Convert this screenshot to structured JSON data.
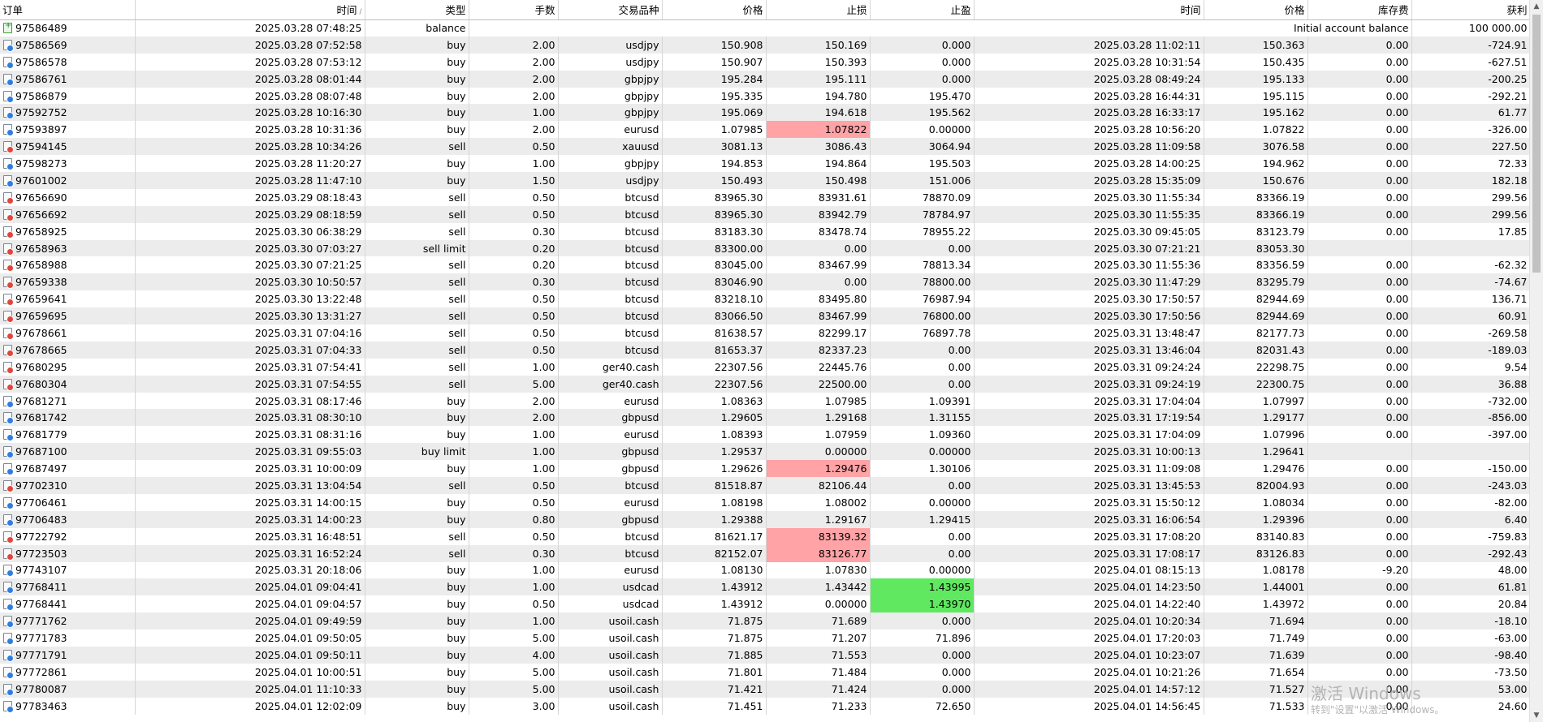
{
  "columns": [
    "订单",
    "时间",
    "类型",
    "手数",
    "交易品种",
    "价格",
    "止损",
    "止盈",
    "时间",
    "价格",
    "库存费",
    "获利"
  ],
  "sort_indicator": "/",
  "balance_row": {
    "order": "97586489",
    "time": "2025.03.28 07:48:25",
    "type": "balance",
    "comment": "Initial account balance",
    "profit": "100 000.00"
  },
  "rows": [
    {
      "order": "97586569",
      "time": "2025.03.28 07:52:58",
      "type": "buy",
      "volume": "2.00",
      "symbol": "usdjpy",
      "price": "150.908",
      "sl": "150.169",
      "tp": "0.000",
      "close_time": "2025.03.28 11:02:11",
      "close_price": "150.363",
      "swap": "0.00",
      "profit": "-724.91"
    },
    {
      "order": "97586578",
      "time": "2025.03.28 07:53:12",
      "type": "buy",
      "volume": "2.00",
      "symbol": "usdjpy",
      "price": "150.907",
      "sl": "150.393",
      "tp": "0.000",
      "close_time": "2025.03.28 10:31:54",
      "close_price": "150.435",
      "swap": "0.00",
      "profit": "-627.51"
    },
    {
      "order": "97586761",
      "time": "2025.03.28 08:01:44",
      "type": "buy",
      "volume": "2.00",
      "symbol": "gbpjpy",
      "price": "195.284",
      "sl": "195.111",
      "tp": "0.000",
      "close_time": "2025.03.28 08:49:24",
      "close_price": "195.133",
      "swap": "0.00",
      "profit": "-200.25"
    },
    {
      "order": "97586879",
      "time": "2025.03.28 08:07:48",
      "type": "buy",
      "volume": "2.00",
      "symbol": "gbpjpy",
      "price": "195.335",
      "sl": "194.780",
      "tp": "195.470",
      "close_time": "2025.03.28 16:44:31",
      "close_price": "195.115",
      "swap": "0.00",
      "profit": "-292.21"
    },
    {
      "order": "97592752",
      "time": "2025.03.28 10:16:30",
      "type": "buy",
      "volume": "1.00",
      "symbol": "gbpjpy",
      "price": "195.069",
      "sl": "194.618",
      "tp": "195.562",
      "close_time": "2025.03.28 16:33:17",
      "close_price": "195.162",
      "swap": "0.00",
      "profit": "61.77"
    },
    {
      "order": "97593897",
      "time": "2025.03.28 10:31:36",
      "type": "buy",
      "volume": "2.00",
      "symbol": "eurusd",
      "price": "1.07985",
      "sl": "1.07822",
      "tp": "0.00000",
      "close_time": "2025.03.28 10:56:20",
      "close_price": "1.07822",
      "swap": "0.00",
      "profit": "-326.00",
      "sl_hit": true
    },
    {
      "order": "97594145",
      "time": "2025.03.28 10:34:26",
      "type": "sell",
      "volume": "0.50",
      "symbol": "xauusd",
      "price": "3081.13",
      "sl": "3086.43",
      "tp": "3064.94",
      "close_time": "2025.03.28 11:09:58",
      "close_price": "3076.58",
      "swap": "0.00",
      "profit": "227.50"
    },
    {
      "order": "97598273",
      "time": "2025.03.28 11:20:27",
      "type": "buy",
      "volume": "1.00",
      "symbol": "gbpjpy",
      "price": "194.853",
      "sl": "194.864",
      "tp": "195.503",
      "close_time": "2025.03.28 14:00:25",
      "close_price": "194.962",
      "swap": "0.00",
      "profit": "72.33"
    },
    {
      "order": "97601002",
      "time": "2025.03.28 11:47:10",
      "type": "buy",
      "volume": "1.50",
      "symbol": "usdjpy",
      "price": "150.493",
      "sl": "150.498",
      "tp": "151.006",
      "close_time": "2025.03.28 15:35:09",
      "close_price": "150.676",
      "swap": "0.00",
      "profit": "182.18"
    },
    {
      "order": "97656690",
      "time": "2025.03.29 08:18:43",
      "type": "sell",
      "volume": "0.50",
      "symbol": "btcusd",
      "price": "83965.30",
      "sl": "83931.61",
      "tp": "78870.09",
      "close_time": "2025.03.30 11:55:34",
      "close_price": "83366.19",
      "swap": "0.00",
      "profit": "299.56"
    },
    {
      "order": "97656692",
      "time": "2025.03.29 08:18:59",
      "type": "sell",
      "volume": "0.50",
      "symbol": "btcusd",
      "price": "83965.30",
      "sl": "83942.79",
      "tp": "78784.97",
      "close_time": "2025.03.30 11:55:35",
      "close_price": "83366.19",
      "swap": "0.00",
      "profit": "299.56"
    },
    {
      "order": "97658925",
      "time": "2025.03.30 06:38:29",
      "type": "sell",
      "volume": "0.30",
      "symbol": "btcusd",
      "price": "83183.30",
      "sl": "83478.74",
      "tp": "78955.22",
      "close_time": "2025.03.30 09:45:05",
      "close_price": "83123.79",
      "swap": "0.00",
      "profit": "17.85"
    },
    {
      "order": "97658963",
      "time": "2025.03.30 07:03:27",
      "type": "sell limit",
      "volume": "0.20",
      "symbol": "btcusd",
      "price": "83300.00",
      "sl": "0.00",
      "tp": "0.00",
      "close_time": "2025.03.30 07:21:21",
      "close_price": "83053.30",
      "swap": "",
      "profit": "",
      "pending": true
    },
    {
      "order": "97658988",
      "time": "2025.03.30 07:21:25",
      "type": "sell",
      "volume": "0.20",
      "symbol": "btcusd",
      "price": "83045.00",
      "sl": "83467.99",
      "tp": "78813.34",
      "close_time": "2025.03.30 11:55:36",
      "close_price": "83356.59",
      "swap": "0.00",
      "profit": "-62.32"
    },
    {
      "order": "97659338",
      "time": "2025.03.30 10:50:57",
      "type": "sell",
      "volume": "0.30",
      "symbol": "btcusd",
      "price": "83046.90",
      "sl": "0.00",
      "tp": "78800.00",
      "close_time": "2025.03.30 11:47:29",
      "close_price": "83295.79",
      "swap": "0.00",
      "profit": "-74.67"
    },
    {
      "order": "97659641",
      "time": "2025.03.30 13:22:48",
      "type": "sell",
      "volume": "0.50",
      "symbol": "btcusd",
      "price": "83218.10",
      "sl": "83495.80",
      "tp": "76987.94",
      "close_time": "2025.03.30 17:50:57",
      "close_price": "82944.69",
      "swap": "0.00",
      "profit": "136.71"
    },
    {
      "order": "97659695",
      "time": "2025.03.30 13:31:27",
      "type": "sell",
      "volume": "0.50",
      "symbol": "btcusd",
      "price": "83066.50",
      "sl": "83467.99",
      "tp": "76800.00",
      "close_time": "2025.03.30 17:50:56",
      "close_price": "82944.69",
      "swap": "0.00",
      "profit": "60.91"
    },
    {
      "order": "97678661",
      "time": "2025.03.31 07:04:16",
      "type": "sell",
      "volume": "0.50",
      "symbol": "btcusd",
      "price": "81638.57",
      "sl": "82299.17",
      "tp": "76897.78",
      "close_time": "2025.03.31 13:48:47",
      "close_price": "82177.73",
      "swap": "0.00",
      "profit": "-269.58"
    },
    {
      "order": "97678665",
      "time": "2025.03.31 07:04:33",
      "type": "sell",
      "volume": "0.50",
      "symbol": "btcusd",
      "price": "81653.37",
      "sl": "82337.23",
      "tp": "0.00",
      "close_time": "2025.03.31 13:46:04",
      "close_price": "82031.43",
      "swap": "0.00",
      "profit": "-189.03"
    },
    {
      "order": "97680295",
      "time": "2025.03.31 07:54:41",
      "type": "sell",
      "volume": "1.00",
      "symbol": "ger40.cash",
      "price": "22307.56",
      "sl": "22445.76",
      "tp": "0.00",
      "close_time": "2025.03.31 09:24:24",
      "close_price": "22298.75",
      "swap": "0.00",
      "profit": "9.54"
    },
    {
      "order": "97680304",
      "time": "2025.03.31 07:54:55",
      "type": "sell",
      "volume": "5.00",
      "symbol": "ger40.cash",
      "price": "22307.56",
      "sl": "22500.00",
      "tp": "0.00",
      "close_time": "2025.03.31 09:24:19",
      "close_price": "22300.75",
      "swap": "0.00",
      "profit": "36.88"
    },
    {
      "order": "97681271",
      "time": "2025.03.31 08:17:46",
      "type": "buy",
      "volume": "2.00",
      "symbol": "eurusd",
      "price": "1.08363",
      "sl": "1.07985",
      "tp": "1.09391",
      "close_time": "2025.03.31 17:04:04",
      "close_price": "1.07997",
      "swap": "0.00",
      "profit": "-732.00"
    },
    {
      "order": "97681742",
      "time": "2025.03.31 08:30:10",
      "type": "buy",
      "volume": "2.00",
      "symbol": "gbpusd",
      "price": "1.29605",
      "sl": "1.29168",
      "tp": "1.31155",
      "close_time": "2025.03.31 17:19:54",
      "close_price": "1.29177",
      "swap": "0.00",
      "profit": "-856.00"
    },
    {
      "order": "97681779",
      "time": "2025.03.31 08:31:16",
      "type": "buy",
      "volume": "1.00",
      "symbol": "eurusd",
      "price": "1.08393",
      "sl": "1.07959",
      "tp": "1.09360",
      "close_time": "2025.03.31 17:04:09",
      "close_price": "1.07996",
      "swap": "0.00",
      "profit": "-397.00"
    },
    {
      "order": "97687100",
      "time": "2025.03.31 09:55:03",
      "type": "buy limit",
      "volume": "1.00",
      "symbol": "gbpusd",
      "price": "1.29537",
      "sl": "0.00000",
      "tp": "0.00000",
      "close_time": "2025.03.31 10:00:13",
      "close_price": "1.29641",
      "swap": "",
      "profit": "",
      "pending": true
    },
    {
      "order": "97687497",
      "time": "2025.03.31 10:00:09",
      "type": "buy",
      "volume": "1.00",
      "symbol": "gbpusd",
      "price": "1.29626",
      "sl": "1.29476",
      "tp": "1.30106",
      "close_time": "2025.03.31 11:09:08",
      "close_price": "1.29476",
      "swap": "0.00",
      "profit": "-150.00",
      "sl_hit": true
    },
    {
      "order": "97702310",
      "time": "2025.03.31 13:04:54",
      "type": "sell",
      "volume": "0.50",
      "symbol": "btcusd",
      "price": "81518.87",
      "sl": "82106.44",
      "tp": "0.00",
      "close_time": "2025.03.31 13:45:53",
      "close_price": "82004.93",
      "swap": "0.00",
      "profit": "-243.03"
    },
    {
      "order": "97706461",
      "time": "2025.03.31 14:00:15",
      "type": "buy",
      "volume": "0.50",
      "symbol": "eurusd",
      "price": "1.08198",
      "sl": "1.08002",
      "tp": "0.00000",
      "close_time": "2025.03.31 15:50:12",
      "close_price": "1.08034",
      "swap": "0.00",
      "profit": "-82.00"
    },
    {
      "order": "97706483",
      "time": "2025.03.31 14:00:23",
      "type": "buy",
      "volume": "0.80",
      "symbol": "gbpusd",
      "price": "1.29388",
      "sl": "1.29167",
      "tp": "1.29415",
      "close_time": "2025.03.31 16:06:54",
      "close_price": "1.29396",
      "swap": "0.00",
      "profit": "6.40"
    },
    {
      "order": "97722792",
      "time": "2025.03.31 16:48:51",
      "type": "sell",
      "volume": "0.50",
      "symbol": "btcusd",
      "price": "81621.17",
      "sl": "83139.32",
      "tp": "0.00",
      "close_time": "2025.03.31 17:08:20",
      "close_price": "83140.83",
      "swap": "0.00",
      "profit": "-759.83",
      "sl_hit": true
    },
    {
      "order": "97723503",
      "time": "2025.03.31 16:52:24",
      "type": "sell",
      "volume": "0.30",
      "symbol": "btcusd",
      "price": "82152.07",
      "sl": "83126.77",
      "tp": "0.00",
      "close_time": "2025.03.31 17:08:17",
      "close_price": "83126.83",
      "swap": "0.00",
      "profit": "-292.43",
      "sl_hit": true
    },
    {
      "order": "97743107",
      "time": "2025.03.31 20:18:06",
      "type": "buy",
      "volume": "1.00",
      "symbol": "eurusd",
      "price": "1.08130",
      "sl": "1.07830",
      "tp": "0.00000",
      "close_time": "2025.04.01 08:15:13",
      "close_price": "1.08178",
      "swap": "-9.20",
      "profit": "48.00"
    },
    {
      "order": "97768411",
      "time": "2025.04.01 09:04:41",
      "type": "buy",
      "volume": "1.00",
      "symbol": "usdcad",
      "price": "1.43912",
      "sl": "1.43442",
      "tp": "1.43995",
      "close_time": "2025.04.01 14:23:50",
      "close_price": "1.44001",
      "swap": "0.00",
      "profit": "61.81",
      "tp_hit": true
    },
    {
      "order": "97768441",
      "time": "2025.04.01 09:04:57",
      "type": "buy",
      "volume": "0.50",
      "symbol": "usdcad",
      "price": "1.43912",
      "sl": "0.00000",
      "tp": "1.43970",
      "close_time": "2025.04.01 14:22:40",
      "close_price": "1.43972",
      "swap": "0.00",
      "profit": "20.84",
      "tp_hit": true
    },
    {
      "order": "97771762",
      "time": "2025.04.01 09:49:59",
      "type": "buy",
      "volume": "1.00",
      "symbol": "usoil.cash",
      "price": "71.875",
      "sl": "71.689",
      "tp": "0.000",
      "close_time": "2025.04.01 10:20:34",
      "close_price": "71.694",
      "swap": "0.00",
      "profit": "-18.10"
    },
    {
      "order": "97771783",
      "time": "2025.04.01 09:50:05",
      "type": "buy",
      "volume": "5.00",
      "symbol": "usoil.cash",
      "price": "71.875",
      "sl": "71.207",
      "tp": "71.896",
      "close_time": "2025.04.01 17:20:03",
      "close_price": "71.749",
      "swap": "0.00",
      "profit": "-63.00"
    },
    {
      "order": "97771791",
      "time": "2025.04.01 09:50:11",
      "type": "buy",
      "volume": "4.00",
      "symbol": "usoil.cash",
      "price": "71.885",
      "sl": "71.553",
      "tp": "0.000",
      "close_time": "2025.04.01 10:23:07",
      "close_price": "71.639",
      "swap": "0.00",
      "profit": "-98.40"
    },
    {
      "order": "97772861",
      "time": "2025.04.01 10:00:51",
      "type": "buy",
      "volume": "5.00",
      "symbol": "usoil.cash",
      "price": "71.801",
      "sl": "71.484",
      "tp": "0.000",
      "close_time": "2025.04.01 10:21:26",
      "close_price": "71.654",
      "swap": "0.00",
      "profit": "-73.50"
    },
    {
      "order": "97780087",
      "time": "2025.04.01 11:10:33",
      "type": "buy",
      "volume": "5.00",
      "symbol": "usoil.cash",
      "price": "71.421",
      "sl": "71.424",
      "tp": "0.000",
      "close_time": "2025.04.01 14:57:12",
      "close_price": "71.527",
      "swap": "0.00",
      "profit": "53.00"
    },
    {
      "order": "97783463",
      "time": "2025.04.01 12:02:09",
      "type": "buy",
      "volume": "3.00",
      "symbol": "usoil.cash",
      "price": "71.451",
      "sl": "71.233",
      "tp": "72.650",
      "close_time": "2025.04.01 14:56:45",
      "close_price": "71.533",
      "swap": "0.00",
      "profit": "24.60"
    }
  ],
  "colors": {
    "sl_hit": "#ffa3a6",
    "tp_hit": "#5fe860",
    "buy_dot": "#2f7de1",
    "sell_dot": "#e0463c"
  },
  "icons": {
    "balance": "balance-icon",
    "buy": "buy-deal-icon",
    "sell": "sell-deal-icon"
  },
  "watermark": {
    "line1": "激活 Windows",
    "line2": "转到\"设置\"以激活 Windows。"
  }
}
